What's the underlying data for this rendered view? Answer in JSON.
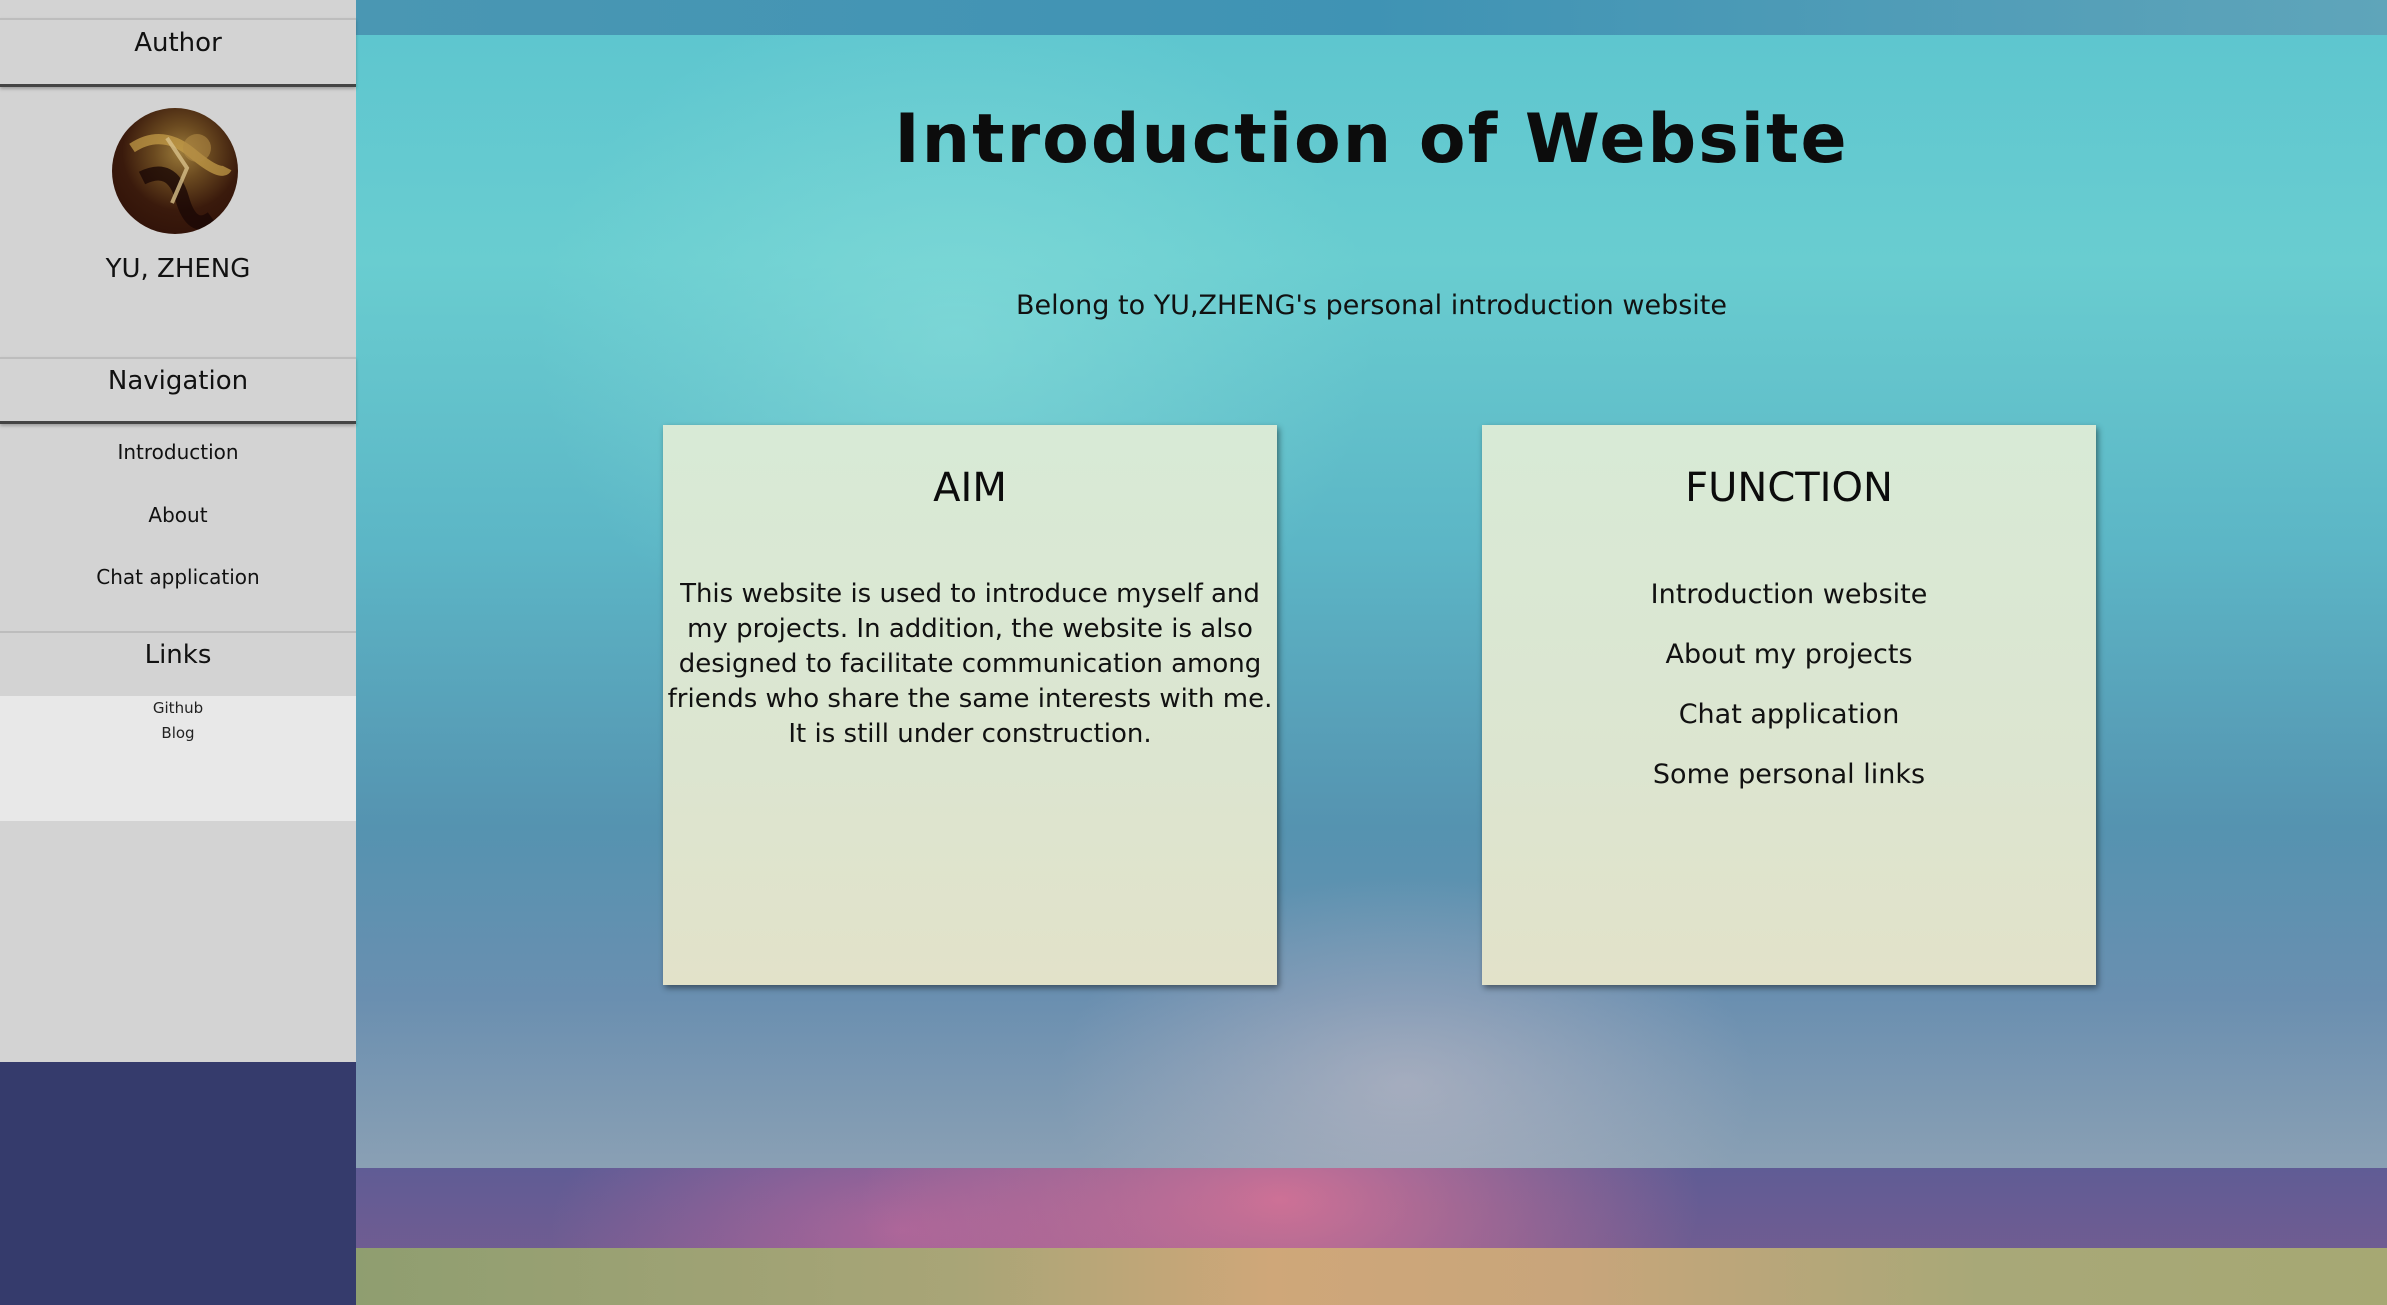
{
  "sidebar": {
    "author_header": "Author",
    "author_name": "YU, ZHENG",
    "navigation_header": "Navigation",
    "nav_items": [
      {
        "label": "Introduction"
      },
      {
        "label": "About"
      },
      {
        "label": "Chat application"
      }
    ],
    "links_header": "Links",
    "links": [
      {
        "label": "Github"
      },
      {
        "label": "Blog"
      }
    ]
  },
  "main": {
    "title": "Introduction of Website",
    "subtitle": "Belong to YU,ZHENG's personal introduction website",
    "aim_card": {
      "title": "AIM",
      "text": "This website is used to introduce myself and my projects. In addition, the website is also designed to facilitate communication among friends who share the same interests with me. It is still under construction."
    },
    "function_card": {
      "title": "FUNCTION",
      "items": [
        {
          "label": "Introduction website"
        },
        {
          "label": "About my projects"
        },
        {
          "label": "Chat application"
        },
        {
          "label": "Some personal links"
        }
      ]
    }
  },
  "colors": {
    "sidebar_bg": "#d3d3d3",
    "links_box_bg": "#e8e8e8",
    "card_bg": "#dce8d4",
    "sidebar_bottom": "#353b6c"
  }
}
